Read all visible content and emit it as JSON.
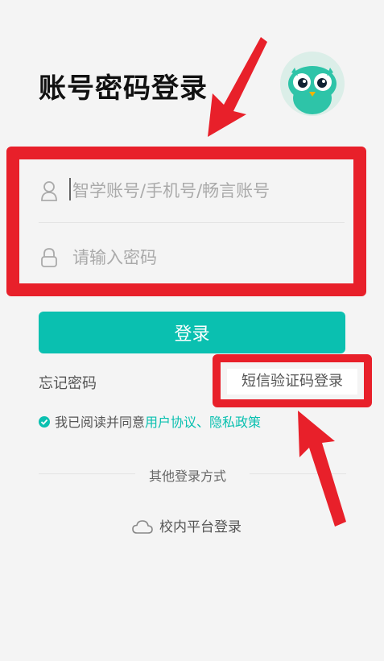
{
  "page": {
    "title": "账号密码登录"
  },
  "form": {
    "account_placeholder": "智学账号/手机号/畅言账号",
    "password_placeholder": "请输入密码"
  },
  "actions": {
    "login_label": "登录",
    "forgot_label": "忘记密码",
    "sms_login_label": "短信验证码登录"
  },
  "agreement": {
    "prefix": "我已阅读并同意",
    "user_agreement": "用户协议",
    "separator": "、",
    "privacy_policy": "隐私政策",
    "checked": true
  },
  "other": {
    "divider_label": "其他登录方式",
    "campus_label": "校内平台登录"
  },
  "colors": {
    "accent": "#0ac0b0",
    "annotation": "#e8202a"
  },
  "icons": [
    "owl-avatar",
    "user-icon",
    "lock-icon",
    "check-icon",
    "cloud-icon"
  ]
}
